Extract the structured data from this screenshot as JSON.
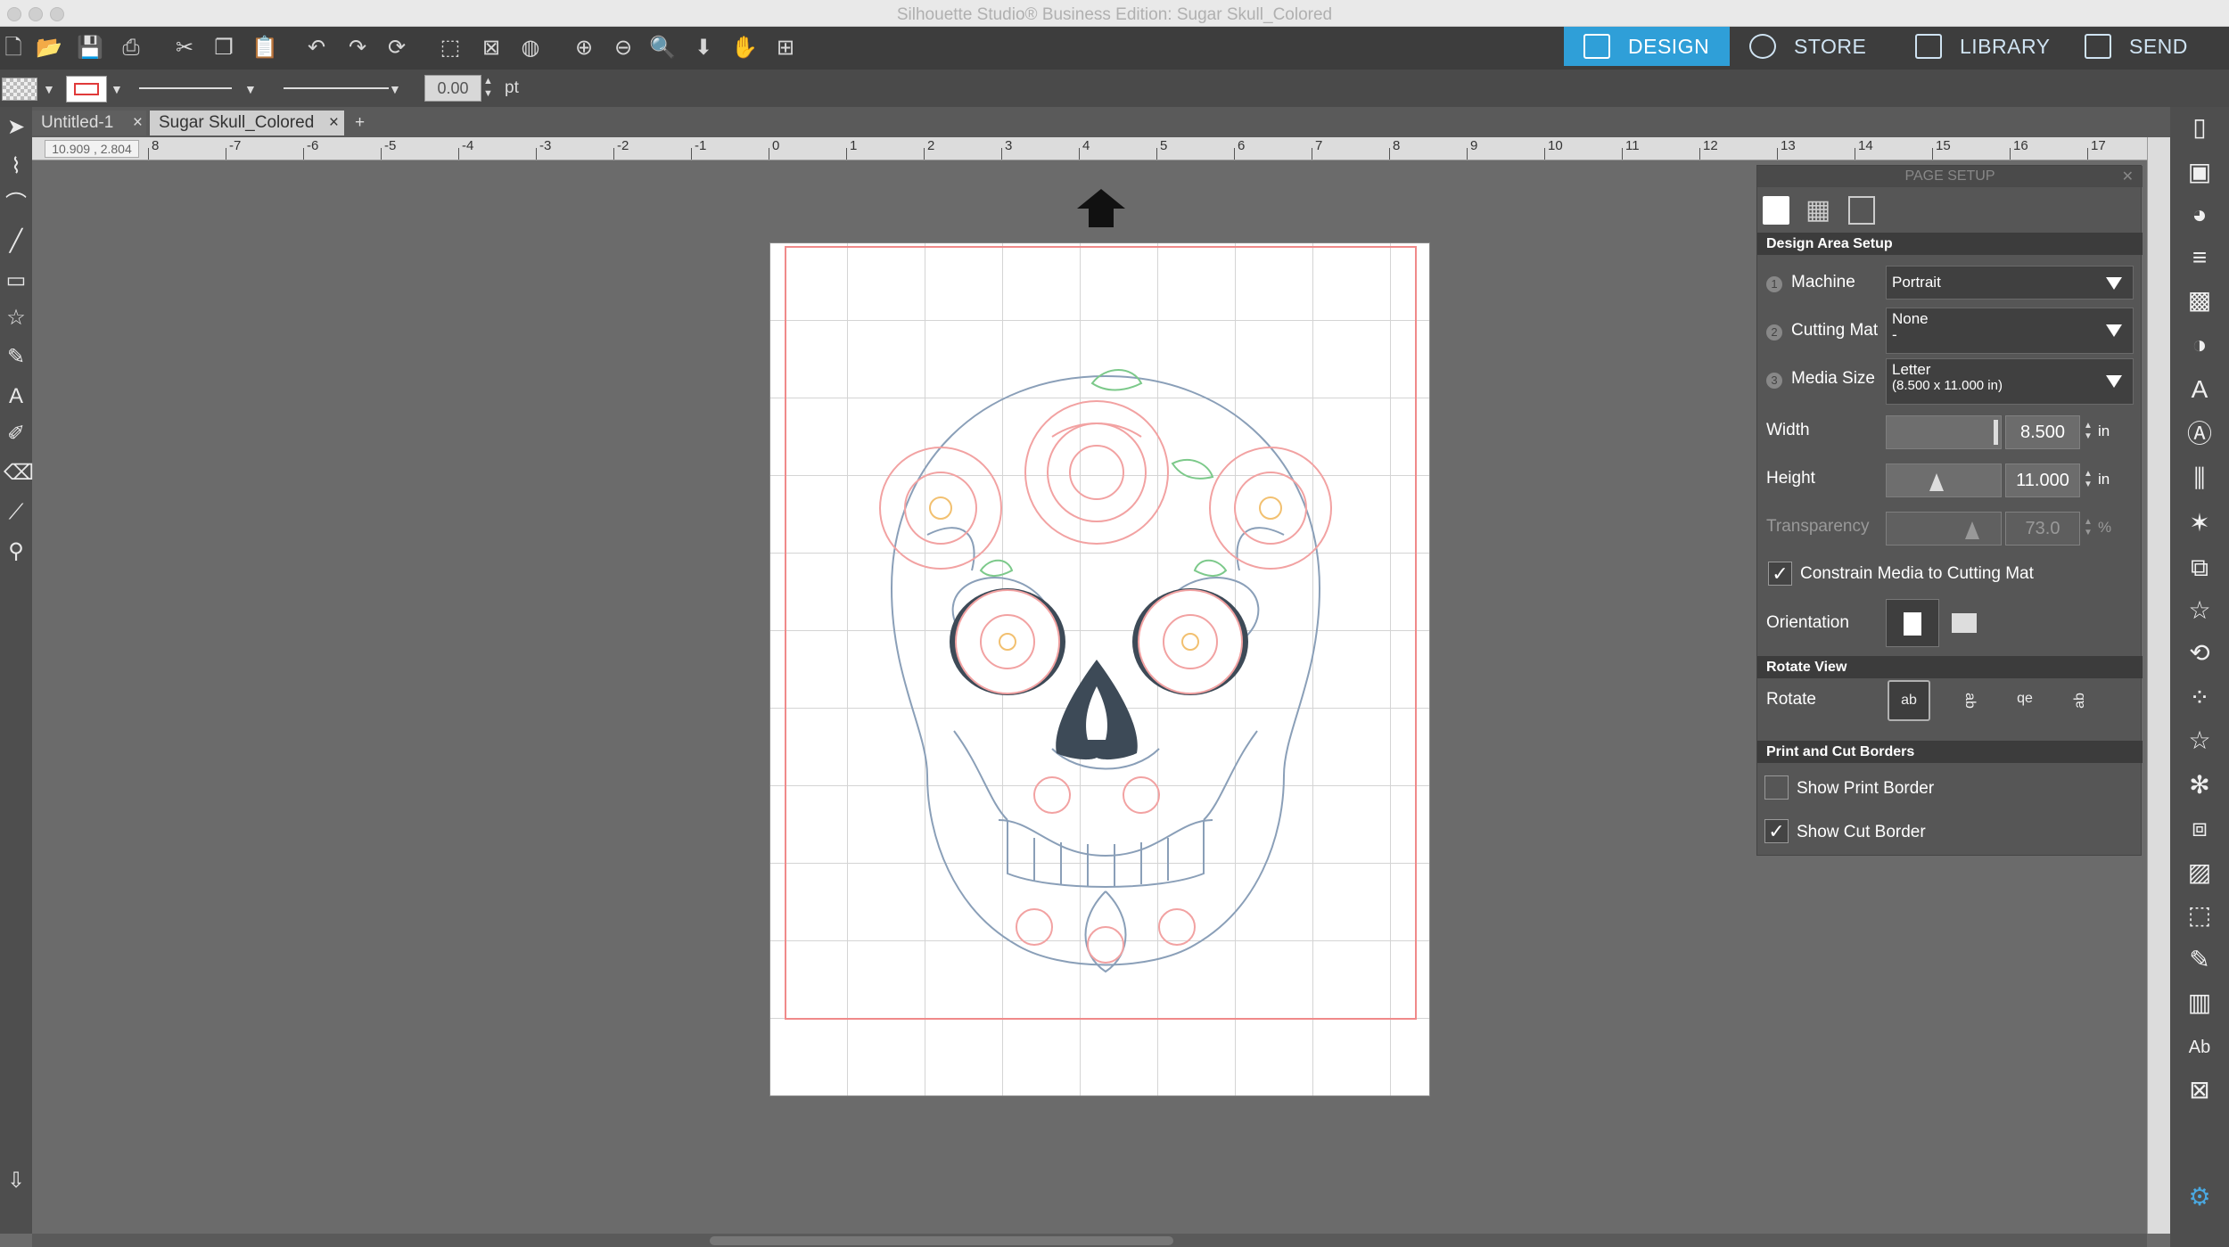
{
  "window": {
    "title": "Silhouette Studio® Business Edition: Sugar Skull_Colored"
  },
  "nav": {
    "design": "DESIGN",
    "store": "STORE",
    "library": "LIBRARY",
    "send": "SEND"
  },
  "line_toolbar": {
    "stroke_value": "0.00",
    "stroke_unit": "pt"
  },
  "tabs": [
    {
      "label": "Untitled-1",
      "close": "×"
    },
    {
      "label": "Sugar Skull_Colored",
      "close": "×"
    },
    {
      "label": "+"
    }
  ],
  "ruler": {
    "coords": "10.909 , 2.804",
    "labels": [
      "8",
      "-7",
      "-6",
      "-5",
      "-4",
      "-3",
      "-2",
      "-1",
      "0",
      "1",
      "2",
      "3",
      "4",
      "5",
      "6",
      "7",
      "8",
      "9",
      "10",
      "11",
      "12",
      "13",
      "14",
      "15",
      "16",
      "17"
    ]
  },
  "panel": {
    "title": "PAGE SETUP",
    "design_area_setup": "Design Area Setup",
    "machine": {
      "num": "1",
      "label": "Machine",
      "value": "Portrait"
    },
    "cutting_mat": {
      "num": "2",
      "label": "Cutting Mat",
      "value": "None",
      "sub": "-"
    },
    "media_size": {
      "num": "3",
      "label": "Media Size",
      "value": "Letter",
      "sub": "(8.500 x 11.000 in)"
    },
    "width": {
      "label": "Width",
      "value": "8.500",
      "unit": "in"
    },
    "height": {
      "label": "Height",
      "value": "11.000",
      "unit": "in"
    },
    "transparency": {
      "label": "Transparency",
      "value": "73.0",
      "unit": "%"
    },
    "constrain": {
      "label": "Constrain Media to Cutting Mat",
      "checked": true
    },
    "orientation": {
      "label": "Orientation"
    },
    "rotate_view": "Rotate View",
    "rotate": {
      "label": "Rotate",
      "options": [
        "ab",
        "ab",
        "qe",
        "ab"
      ]
    },
    "print_cut_borders": "Print and Cut Borders",
    "show_print_border": {
      "label": "Show Print Border",
      "checked": false
    },
    "show_cut_border": {
      "label": "Show Cut Border",
      "checked": true
    }
  },
  "colors": {
    "accent": "#2f9fd8",
    "cut_border": "#f08a8a",
    "panel_bg": "#565656",
    "flower": "#f2a2a2",
    "leaf": "#7cc98a",
    "skull_line": "#8a9fb8"
  }
}
